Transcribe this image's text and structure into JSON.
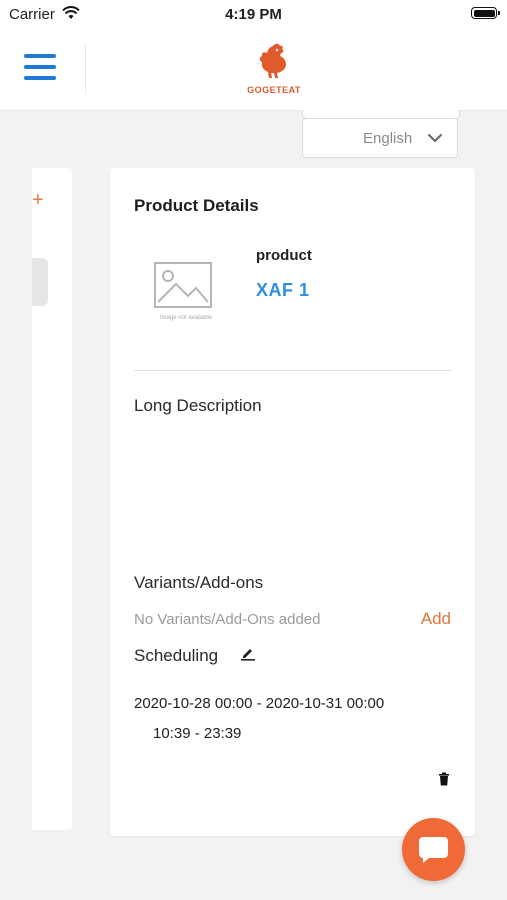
{
  "status_bar": {
    "carrier": "Carrier",
    "time": "4:19 PM"
  },
  "header": {
    "logo_text": "GOGETEAT",
    "brand_color": "#e05a2b",
    "accent_color": "#1f7ad6"
  },
  "language": {
    "selected": "English"
  },
  "product": {
    "section_title": "Product Details",
    "image_placeholder": "Image not available",
    "name": "product",
    "price": "XAF 1"
  },
  "long_description": {
    "label": "Long Description"
  },
  "variants": {
    "label": "Variants/Add-ons",
    "empty_text": "No Variants/Add-Ons added",
    "add_label": "Add"
  },
  "scheduling": {
    "label": "Scheduling",
    "date_range": "2020-10-28 00:00 - 2020-10-31 00:00",
    "time_range": "10:39 - 23:39"
  },
  "icons": [
    "wifi-icon",
    "battery-icon",
    "menu-icon",
    "chevron-down-icon",
    "image-placeholder-icon",
    "edit-icon",
    "trash-icon",
    "chat-icon"
  ]
}
